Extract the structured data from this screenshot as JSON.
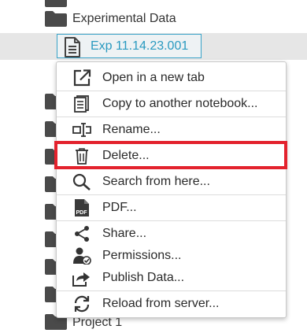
{
  "tree": {
    "folders": [
      {
        "label": "Experimental Data"
      },
      {
        "label": "Project 1"
      }
    ],
    "selected_node": {
      "label": "Exp 11.14.23.001",
      "icon": "document-icon"
    }
  },
  "context_menu": {
    "items": [
      {
        "label": "Open in a new tab",
        "icon": "external-link-icon"
      },
      {
        "label": "Copy to another notebook...",
        "icon": "copy-notebook-icon"
      },
      {
        "label": "Rename...",
        "icon": "rename-icon"
      },
      {
        "label": "Delete...",
        "icon": "trash-icon"
      },
      {
        "label": "Search from here...",
        "icon": "search-icon"
      },
      {
        "label": "PDF...",
        "icon": "pdf-icon"
      },
      {
        "label": "Share...",
        "icon": "share-icon"
      },
      {
        "label": "Permissions...",
        "icon": "permissions-icon"
      },
      {
        "label": "Publish Data...",
        "icon": "publish-icon"
      },
      {
        "label": "Reload from server...",
        "icon": "reload-icon"
      }
    ],
    "highlighted_item": "Delete..."
  },
  "colors": {
    "highlight": "#e3222d",
    "selected_text": "#2a9ac0",
    "selected_border": "#3aa3c8",
    "folder": "#4a4a4a",
    "selected_row": "#e6e6e6"
  }
}
